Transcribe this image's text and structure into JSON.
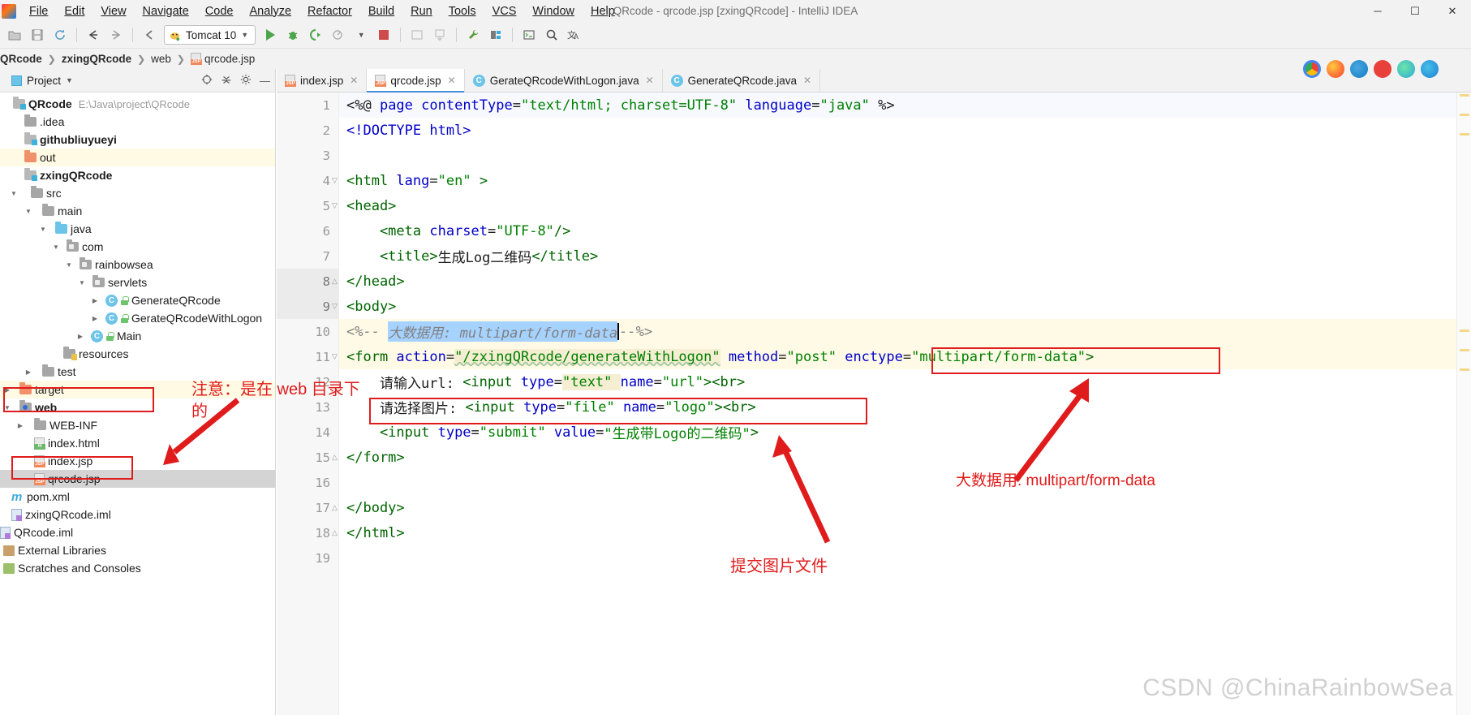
{
  "window": {
    "title": "QRcode - qrcode.jsp [zxingQRcode] - IntelliJ IDEA",
    "minimize": "─",
    "maximize": "☐",
    "close": "✕"
  },
  "menu": [
    {
      "label": "File"
    },
    {
      "label": "Edit"
    },
    {
      "label": "View"
    },
    {
      "label": "Navigate"
    },
    {
      "label": "Code"
    },
    {
      "label": "Analyze"
    },
    {
      "label": "Refactor"
    },
    {
      "label": "Build"
    },
    {
      "label": "Run"
    },
    {
      "label": "Tools"
    },
    {
      "label": "VCS"
    },
    {
      "label": "Window"
    },
    {
      "label": "Help"
    }
  ],
  "toolbar": {
    "run_config": "Tomcat 10",
    "icons": [
      "open-icon",
      "save-icon",
      "sync-icon",
      "back-icon",
      "forward-icon",
      "undo-icon",
      "run-icon",
      "debug-icon",
      "run-coverage-icon",
      "profile-icon",
      "stop-icon",
      "layout-icon",
      "update-icon",
      "settings-wrench-icon",
      "structure-icon",
      "terminal-icon",
      "search-icon",
      "translate-icon"
    ]
  },
  "breadcrumb": [
    {
      "label": "QRcode",
      "bold": true
    },
    {
      "label": "zxingQRcode",
      "bold": true
    },
    {
      "label": "web",
      "bold": false
    },
    {
      "label": "qrcode.jsp",
      "bold": false,
      "icon": "jsp-file-icon"
    }
  ],
  "sidebar": {
    "title": "Project",
    "tools": [
      "target-icon",
      "collapse-all-icon",
      "gear-icon",
      "hide-icon"
    ],
    "tree": [
      {
        "label": "QRcode",
        "path": "E:\\Java\\project\\QRcode",
        "indent": 0,
        "icon": "project-root",
        "bold": true,
        "arrow": "none"
      },
      {
        "label": ".idea",
        "indent": 1,
        "icon": "folder-grey",
        "arrow": "none"
      },
      {
        "label": "githubliuyueyi",
        "indent": 1,
        "icon": "module-folder",
        "bold": true,
        "arrow": "none"
      },
      {
        "label": "out",
        "indent": 1,
        "icon": "folder-orange",
        "arrow": "none",
        "highlight": true
      },
      {
        "label": "zxingQRcode",
        "indent": 1,
        "icon": "module-folder",
        "bold": true,
        "arrow": "none"
      },
      {
        "label": "src",
        "indent": 2,
        "icon": "folder-grey",
        "arrow": "open"
      },
      {
        "label": "main",
        "indent": 3,
        "icon": "folder-grey",
        "arrow": "open"
      },
      {
        "label": "java",
        "indent": 4,
        "icon": "folder-blue",
        "arrow": "open"
      },
      {
        "label": "com",
        "indent": 5,
        "icon": "folder-package",
        "arrow": "open"
      },
      {
        "label": "rainbowsea",
        "indent": 6,
        "icon": "folder-package",
        "arrow": "open"
      },
      {
        "label": "servlets",
        "indent": 7,
        "icon": "folder-package",
        "arrow": "open"
      },
      {
        "label": "GenerateQRcode",
        "indent": 8,
        "icon": "java-class-icon",
        "arrow": "closed",
        "lock": true
      },
      {
        "label": "GerateQRcodeWithLogon",
        "indent": 8,
        "icon": "java-class-icon",
        "arrow": "closed",
        "lock": true
      },
      {
        "label": "Main",
        "indent": 7,
        "icon": "java-runnable-class-icon",
        "arrow": "closed",
        "lock": true
      },
      {
        "label": "resources",
        "indent": 5,
        "icon": "folder-resources",
        "arrow": "none"
      },
      {
        "label": "test",
        "indent": 3,
        "icon": "folder-grey",
        "arrow": "closed"
      },
      {
        "label": "target",
        "indent": 2,
        "icon": "folder-orange",
        "arrow": "closed",
        "highlight": true
      },
      {
        "label": "web",
        "indent": 2,
        "icon": "folder-web",
        "arrow": "open",
        "boxed": true,
        "bold": false
      },
      {
        "label": "WEB-INF",
        "indent": 3,
        "icon": "folder-grey",
        "arrow": "closed"
      },
      {
        "label": "index.html",
        "indent": 3,
        "icon": "html-file-icon",
        "arrow": "none"
      },
      {
        "label": "index.jsp",
        "indent": 3,
        "icon": "jsp-file-icon",
        "arrow": "none"
      },
      {
        "label": "qrcode.jsp",
        "indent": 3,
        "icon": "jsp-file-icon",
        "arrow": "none",
        "selected": true,
        "boxed": true
      },
      {
        "label": "pom.xml",
        "indent": 1,
        "icon": "maven-file-icon",
        "arrow": "none"
      },
      {
        "label": "zxingQRcode.iml",
        "indent": 1,
        "icon": "iml-file-icon",
        "arrow": "none"
      },
      {
        "label": "QRcode.iml",
        "indent": 0,
        "icon": "iml-file-icon",
        "arrow": "none"
      },
      {
        "label": "External Libraries",
        "indent": 0,
        "icon": "library-icon",
        "arrow": "closed"
      },
      {
        "label": "Scratches and Consoles",
        "indent": 0,
        "icon": "scratches-icon",
        "arrow": "closed"
      }
    ]
  },
  "editor": {
    "tabs": [
      {
        "label": "index.jsp",
        "icon": "jsp-file-icon",
        "active": false
      },
      {
        "label": "qrcode.jsp",
        "icon": "jsp-file-icon",
        "active": true
      },
      {
        "label": "GerateQRcodeWithLogon.java",
        "icon": "java-class-icon",
        "active": false
      },
      {
        "label": "GenerateQRcode.java",
        "icon": "java-class-icon",
        "active": false
      }
    ],
    "lines": [
      {
        "n": "1",
        "fold": "",
        "highlight": false
      },
      {
        "n": "2",
        "fold": "",
        "highlight": false
      },
      {
        "n": "3",
        "fold": "",
        "highlight": false
      },
      {
        "n": "4",
        "fold": "open",
        "highlight": false
      },
      {
        "n": "5",
        "fold": "open",
        "highlight": false
      },
      {
        "n": "6",
        "fold": "",
        "highlight": false
      },
      {
        "n": "7",
        "fold": "",
        "highlight": false
      },
      {
        "n": "8",
        "fold": "close",
        "highlight": false
      },
      {
        "n": "9",
        "fold": "open",
        "highlight": false
      },
      {
        "n": "10",
        "fold": "",
        "highlight": true
      },
      {
        "n": "11",
        "fold": "open",
        "highlight": true
      },
      {
        "n": "12",
        "fold": "",
        "highlight": false
      },
      {
        "n": "13",
        "fold": "",
        "highlight": false
      },
      {
        "n": "14",
        "fold": "",
        "highlight": false
      },
      {
        "n": "15",
        "fold": "close",
        "highlight": false
      },
      {
        "n": "16",
        "fold": "",
        "highlight": false
      },
      {
        "n": "17",
        "fold": "close",
        "highlight": false
      },
      {
        "n": "18",
        "fold": "close",
        "highlight": false
      },
      {
        "n": "19",
        "fold": "",
        "highlight": false
      }
    ],
    "code": {
      "l1_a": "<%@ ",
      "l1_b": "page ",
      "l1_c": "contentType",
      "l1_d": "=",
      "l1_e": "\"text/html; charset=UTF-8\" ",
      "l1_f": "language",
      "l1_g": "=",
      "l1_h": "\"java\" ",
      "l1_i": "%>",
      "l2": "<!DOCTYPE html>",
      "l4_a": "<html ",
      "l4_b": "lang",
      "l4_c": "=",
      "l4_d": "\"en\"",
      "l4_e": " >",
      "l5": "<head>",
      "l6_a": "    <meta ",
      "l6_b": "charset",
      "l6_c": "=",
      "l6_d": "\"UTF-8\"",
      "l6_e": "/>",
      "l7_a": "    <title>",
      "l7_b": "生成Log二维码",
      "l7_c": "</title>",
      "l8": "</head>",
      "l9": "<body>",
      "l10_a": "<%-- ",
      "l10_b": "大数据用: multipart/form-data",
      "l10_c": "--%>",
      "l11_a": "<form ",
      "l11_b": "action",
      "l11_c": "=",
      "l11_d": "\"/zxingQRcode/generateWithLogon\"",
      "l11_e": " ",
      "l11_f": "method",
      "l11_g": "=",
      "l11_h": "\"post\"",
      "l11_i": " ",
      "l11_j": "enctype",
      "l11_k": "=",
      "l11_l": "\"multipart/form-data\"",
      "l11_m": ">",
      "l12_a": "    请输入url: ",
      "l12_b": "<input ",
      "l12_c": "type",
      "l12_d": "=",
      "l12_e": "\"text\" ",
      "l12_f": "name",
      "l12_g": "=",
      "l12_h": "\"url\"",
      "l12_i": ">",
      "l12_j": "<br>",
      "l13_a": "    请选择图片: ",
      "l13_b": "<input ",
      "l13_c": "type",
      "l13_d": "=",
      "l13_e": "\"file\" ",
      "l13_f": "name",
      "l13_g": "=",
      "l13_h": "\"logo\"",
      "l13_i": ">",
      "l13_j": "<br>",
      "l14_a": "    <input ",
      "l14_b": "type",
      "l14_c": "=",
      "l14_d": "\"submit\" ",
      "l14_e": "value",
      "l14_f": "=",
      "l14_g": "\"生成带Logo的二维码\"",
      "l14_h": ">",
      "l15": "</form>",
      "l17": "</body>",
      "l18": "</html>"
    }
  },
  "annotations": {
    "note_web_line1": "注意：是在 web 目录下",
    "note_web_line2": "的",
    "note_submit_file": "提交图片文件",
    "note_multipart": "大数据用: multipart/form-data"
  },
  "watermark": "CSDN @ChinaRainbowSea",
  "colors": {
    "annotation_red": "#e01b1b",
    "tab_accent": "#4a90d9",
    "selection_blue": "#a6d2ff",
    "line_highlight": "#fffae6",
    "tag_blue": "#0000c8",
    "string_green": "#008000",
    "comment_grey": "#808080"
  }
}
